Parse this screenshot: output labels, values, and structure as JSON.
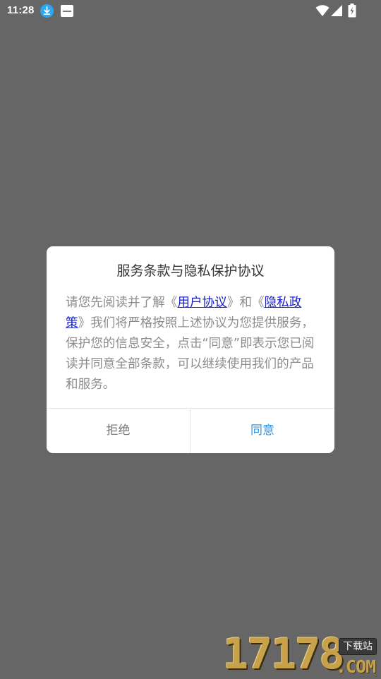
{
  "status_bar": {
    "time": "11:28",
    "icons": [
      "download-icon",
      "app-notification-icon",
      "wifi-icon",
      "signal-icon",
      "battery-charging-icon"
    ],
    "download_color": "#29a9f5"
  },
  "dialog": {
    "title": "服务条款与隐私保护协议",
    "body": {
      "prefix": "请您先阅读并了解《",
      "user_agreement_link": "用户协议",
      "middle": "》和《",
      "privacy_policy_link": "隐私政策",
      "suffix": "》我们将严格按照上述协议为您提供服务，保护您的信息安全，点击“同意”即表示您已阅读并同意全部条款，可以继续使用我们的产品和服务。"
    },
    "buttons": {
      "reject": "拒绝",
      "agree": "同意"
    },
    "colors": {
      "link": "#1a22c8",
      "agree": "#2d96e8",
      "body_text": "#8d8d8d",
      "overlay": "#666666"
    }
  },
  "watermark": {
    "digits": "17178",
    "badge": "下载站",
    "domain": ".COM"
  }
}
